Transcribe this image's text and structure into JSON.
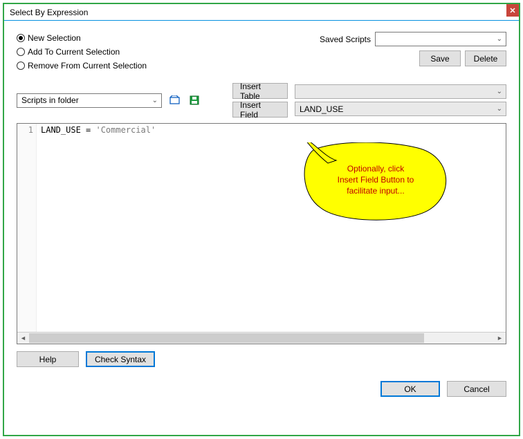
{
  "window": {
    "title": "Select By Expression",
    "close_glyph": "✕"
  },
  "radios": {
    "new_selection": "New Selection",
    "add_to": "Add To Current Selection",
    "remove_from": "Remove From Current Selection"
  },
  "saved": {
    "label": "Saved Scripts",
    "value": "",
    "save_btn": "Save",
    "delete_btn": "Delete"
  },
  "scripts_combo": {
    "value": "Scripts in folder"
  },
  "insert": {
    "table_btn": "Insert Table",
    "field_btn": "Insert Field",
    "table_value": "",
    "field_value": "LAND_USE"
  },
  "editor": {
    "line_no": "1",
    "code_plain": "LAND_USE = ",
    "code_string": "'Commercial'"
  },
  "buttons": {
    "help": "Help",
    "check_syntax": "Check Syntax",
    "ok": "OK",
    "cancel": "Cancel"
  },
  "callout": {
    "line1": "Optionally, click",
    "line2": "Insert Field Button to",
    "line3": "facilitate input..."
  }
}
